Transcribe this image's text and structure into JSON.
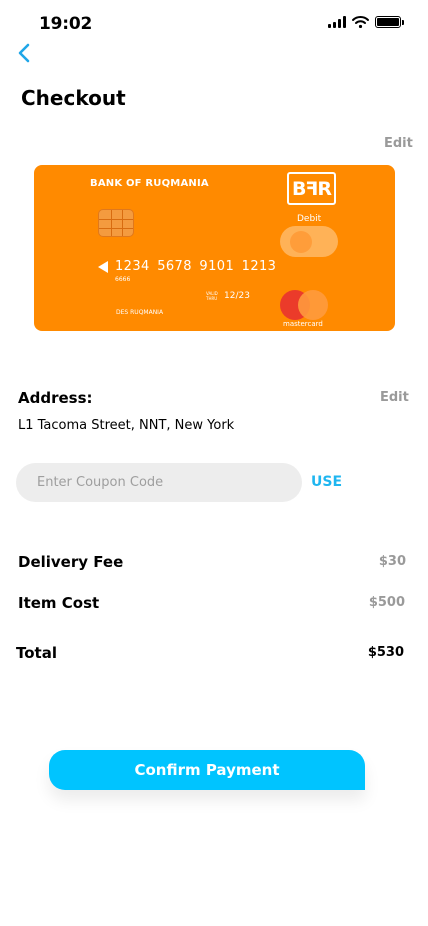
{
  "status_bar": {
    "time": "19:02"
  },
  "header": {
    "title": "Checkout"
  },
  "card_section": {
    "edit_label": "Edit",
    "card": {
      "bank_name": "BANK OF RUQMANIA",
      "logo_text": "BꟻR",
      "type_label": "Debit",
      "number": "1234  5678  9101  1213",
      "short_number": "6666",
      "valid_label": "VALID THRU",
      "expiry": "12/23",
      "holder": "DES RUQMANIA",
      "network": "mastercard"
    }
  },
  "address": {
    "label": "Address:",
    "edit_label": "Edit",
    "value": "L1 Tacoma Street, NNT, New York"
  },
  "coupon": {
    "placeholder": "Enter Coupon Code",
    "button_label": "USE"
  },
  "summary": {
    "delivery_label": "Delivery Fee",
    "delivery_value": "$30",
    "item_label": "Item Cost",
    "item_value": "$500",
    "total_label": "Total",
    "total_value": "$530"
  },
  "actions": {
    "confirm_label": "Confirm Payment"
  },
  "colors": {
    "card": "#ff8a00",
    "accent": "#00c4ff",
    "link": "#1fb6f0"
  }
}
